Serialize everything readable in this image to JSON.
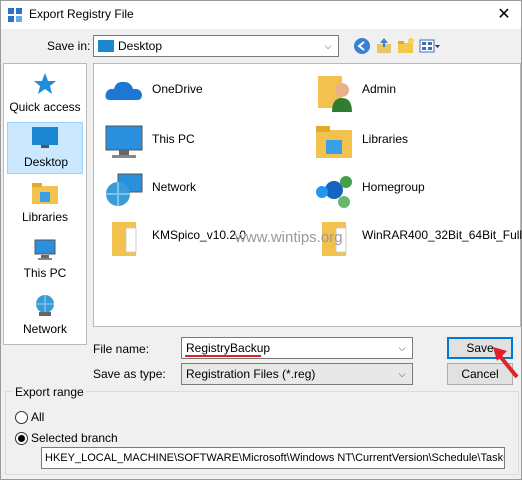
{
  "window": {
    "title": "Export Registry File",
    "close_glyph": "✕"
  },
  "toolbar": {
    "save_in_label": "Save in:",
    "save_in_value": "Desktop",
    "icons": [
      "back-icon",
      "up-folder-icon",
      "new-folder-icon",
      "view-menu-icon"
    ]
  },
  "places": [
    {
      "label": "Quick access",
      "icon": "star-icon"
    },
    {
      "label": "Desktop",
      "icon": "desktop-icon",
      "selected": true
    },
    {
      "label": "Libraries",
      "icon": "libraries-icon"
    },
    {
      "label": "This PC",
      "icon": "computer-icon"
    },
    {
      "label": "Network",
      "icon": "network-icon"
    }
  ],
  "files": [
    {
      "name": "OneDrive",
      "icon": "onedrive-icon"
    },
    {
      "name": "Admin",
      "icon": "user-folder-icon"
    },
    {
      "name": "This PC",
      "icon": "computer-icon"
    },
    {
      "name": "Libraries",
      "icon": "libraries-icon"
    },
    {
      "name": "Network",
      "icon": "network-icon"
    },
    {
      "name": "Homegroup",
      "icon": "homegroup-icon"
    },
    {
      "name": "KMSpico_v10.2.0",
      "icon": "folder-icon"
    },
    {
      "name": "WinRAR400_32Bit_64Bit_Full",
      "icon": "folder-icon"
    }
  ],
  "watermark": "www.wintips.org",
  "form": {
    "file_name_label": "File name:",
    "file_name_value": "RegistryBackup",
    "save_as_type_label": "Save as type:",
    "save_as_type_value": "Registration Files (*.reg)",
    "save_button": "Save",
    "cancel_button": "Cancel"
  },
  "export_range": {
    "title": "Export range",
    "all_label": "All",
    "selected_branch_label": "Selected branch",
    "selected": "Selected branch",
    "branch_path": "HKEY_LOCAL_MACHINE\\SOFTWARE\\Microsoft\\Windows NT\\CurrentVersion\\Schedule\\TaskCache"
  },
  "colors": {
    "accent": "#0078d7",
    "selection": "#cce8ff",
    "annotation_red": "#e0202a"
  }
}
